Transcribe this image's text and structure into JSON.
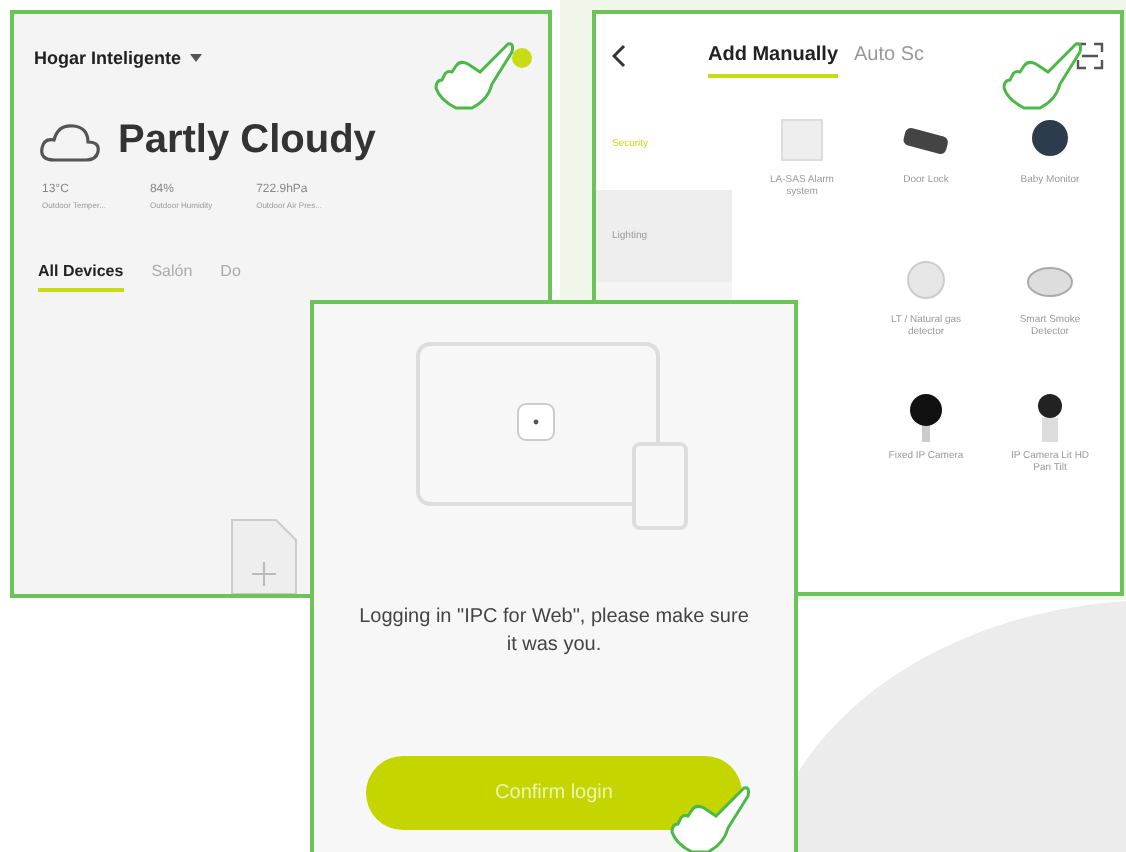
{
  "home": {
    "title": "Hogar Inteligente",
    "weather": "Partly Cloudy",
    "stats": [
      {
        "value": "13°C",
        "label": "Outdoor Temper..."
      },
      {
        "value": "84%",
        "label": "Outdoor Humidity"
      },
      {
        "value": "722.9hPa",
        "label": "Outdoor Air Pres..."
      }
    ],
    "tabs": [
      {
        "label": "All Devices",
        "selected": true
      },
      {
        "label": "Salón",
        "selected": false
      },
      {
        "label": "Do",
        "selected": false
      }
    ]
  },
  "add_device": {
    "tabs": [
      {
        "label": "Add Manually",
        "selected": true
      },
      {
        "label": "Auto Sc",
        "selected": false
      }
    ],
    "categories": [
      {
        "label": "Security",
        "selected": true
      },
      {
        "label": "Lighting",
        "selected": false
      }
    ],
    "devices": [
      {
        "name": "LA-SAS Alarm system",
        "kind": "panel"
      },
      {
        "name": "Door Lock",
        "kind": "lock"
      },
      {
        "name": "Baby Monitor",
        "kind": "monitor"
      },
      {
        "kind": "none"
      },
      {
        "name": "LT / Natural gas detector",
        "kind": "detector"
      },
      {
        "name": "Smart Smoke Detector",
        "kind": "smoke"
      },
      {
        "kind": "none"
      },
      {
        "name": "Fixed IP Camera",
        "kind": "camera"
      },
      {
        "name": "IP Camera Lit HD Pan Tilt",
        "kind": "pancam"
      }
    ]
  },
  "login": {
    "message": "Logging in \"IPC for Web\", please make sure it was you.",
    "button": "Confirm login"
  }
}
